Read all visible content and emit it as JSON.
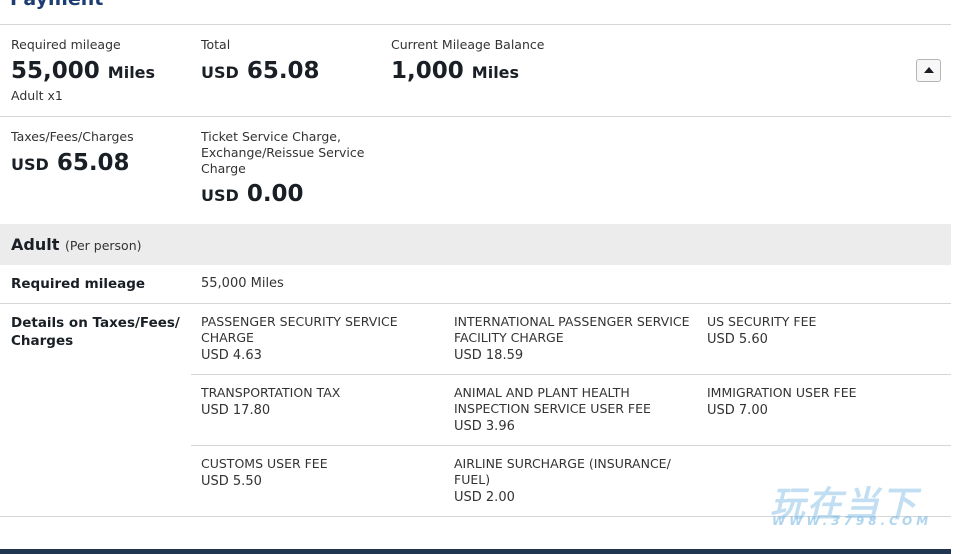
{
  "heading": "Payment",
  "summary": {
    "required_label": "Required mileage",
    "required_value": "55,000",
    "required_unit": "Miles",
    "adult_count": "Adult x1",
    "total_label": "Total",
    "total_currency": "USD",
    "total_value": "65.08",
    "balance_label": "Current Mileage Balance",
    "balance_value": "1,000",
    "balance_unit": "Miles"
  },
  "taxes": {
    "label": "Taxes/Fees/Charges",
    "currency": "USD",
    "value": "65.08"
  },
  "ticket_service": {
    "label": "Ticket Service Charge, Exchange/Reissue Service Charge",
    "currency": "USD",
    "value": "0.00"
  },
  "adult": {
    "title": "Adult",
    "subtitle": "(Per person)",
    "required_label": "Required mileage",
    "required_value": "55,000 Miles",
    "details_label": "Details on Taxes/Fees/ Charges"
  },
  "fees": [
    {
      "name": "PASSENGER SECURITY SERVICE CHARGE",
      "amount": "USD 4.63"
    },
    {
      "name": "INTERNATIONAL PASSENGER SERVICE FACILITY CHARGE",
      "amount": "USD 18.59"
    },
    {
      "name": "US SECURITY FEE",
      "amount": "USD 5.60"
    },
    {
      "name": "TRANSPORTATION TAX",
      "amount": "USD 17.80"
    },
    {
      "name": "ANIMAL AND PLANT HEALTH INSPECTION SERVICE USER FEE",
      "amount": "USD 3.96"
    },
    {
      "name": "IMMIGRATION USER FEE",
      "amount": "USD 7.00"
    },
    {
      "name": "CUSTOMS USER FEE",
      "amount": "USD 5.50"
    },
    {
      "name": "AIRLINE SURCHARGE (INSURANCE/ FUEL)",
      "amount": "USD 2.00"
    }
  ],
  "watermark": {
    "main": "玩在当下",
    "sub": "WWW.3798.COM"
  },
  "icons": {
    "collapse": "caret-up-icon"
  }
}
